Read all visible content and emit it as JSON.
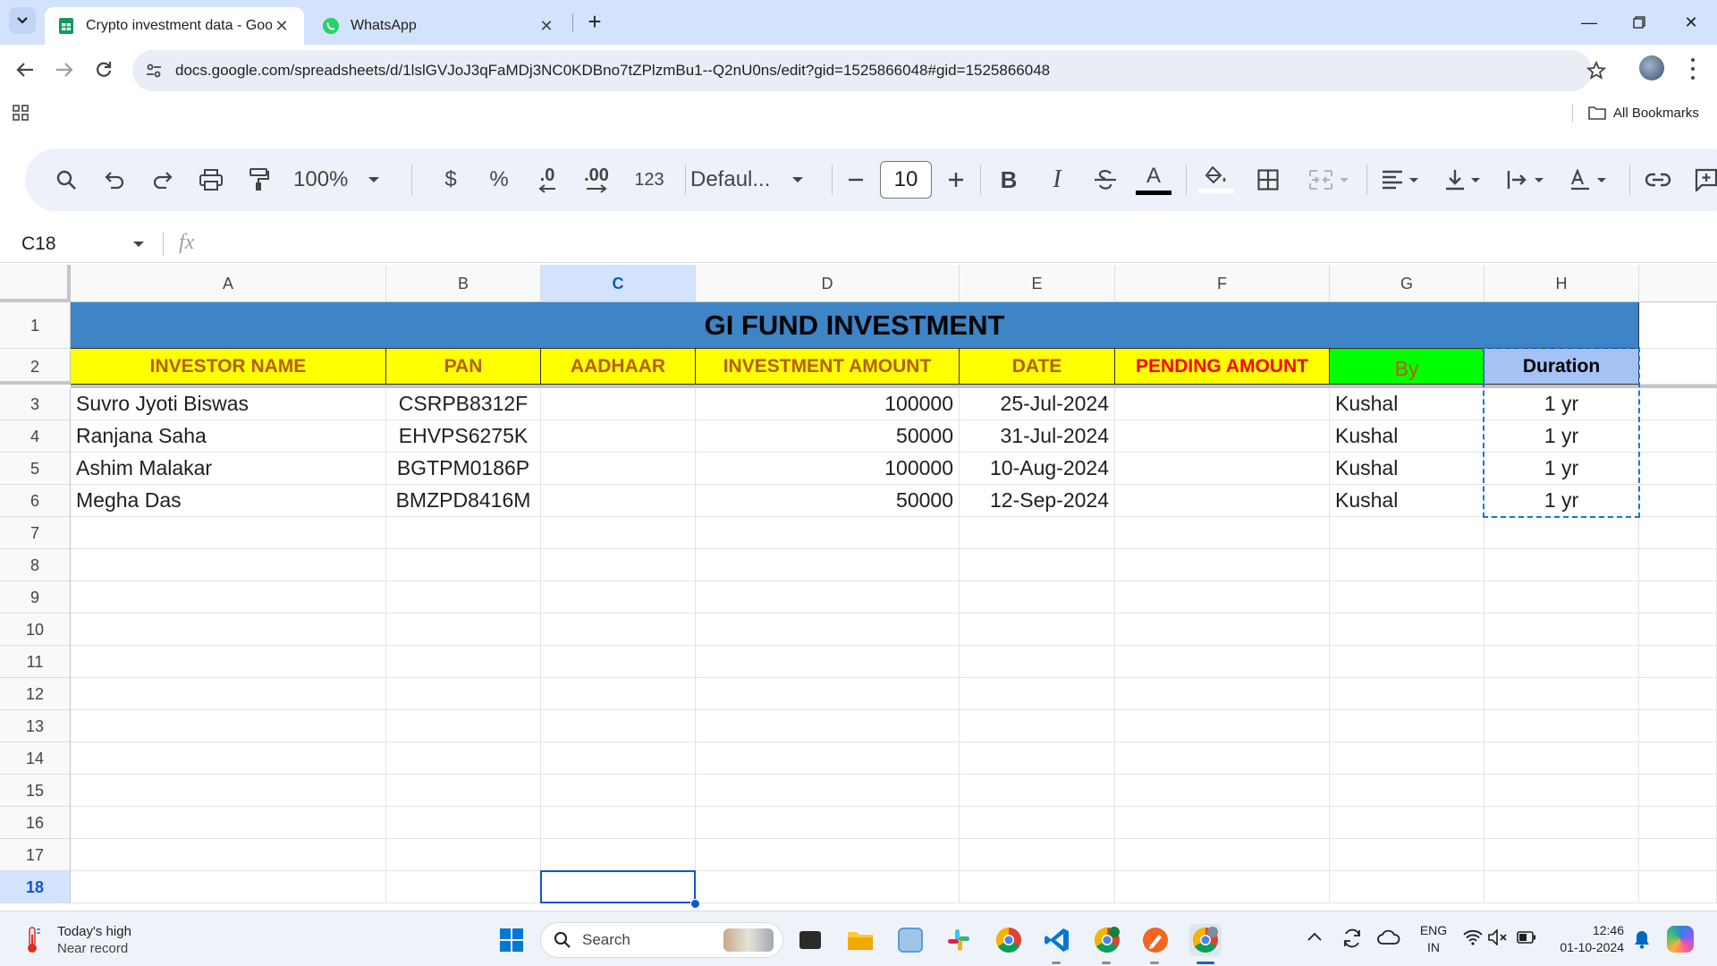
{
  "browser": {
    "tabs": [
      {
        "title": "Crypto investment data - Googl",
        "active": true
      },
      {
        "title": "WhatsApp",
        "active": false
      }
    ],
    "url": "docs.google.com/spreadsheets/d/1lslGVJoJ3qFaMDj3NC0KDBno7tZPlzmBu1--Q2nU0ns/edit?gid=1525866048#gid=1525866048",
    "bookmarks_label": "All Bookmarks"
  },
  "toolbar": {
    "zoom": "100%",
    "currency": "$",
    "percent": "%",
    "decrease_decimal": ".0",
    "increase_decimal": ".00",
    "number_format": "123",
    "font": "Defaul...",
    "font_size": "10"
  },
  "formula_bar": {
    "cell_ref": "C18",
    "fx": "fx"
  },
  "sheet": {
    "columns": [
      "A",
      "B",
      "C",
      "D",
      "E",
      "F",
      "G",
      "H"
    ],
    "row_numbers": [
      "1",
      "2",
      "3",
      "4",
      "5",
      "6",
      "7",
      "8",
      "9",
      "10",
      "11",
      "12",
      "13",
      "14",
      "15",
      "16",
      "17",
      "18"
    ],
    "title": "GI FUND INVESTMENT",
    "headers": [
      "INVESTOR NAME",
      "PAN",
      "AADHAAR",
      "INVESTMENT AMOUNT",
      "DATE",
      "PENDING AMOUNT",
      "By",
      "Duration"
    ],
    "rows": [
      [
        "Suvro Jyoti Biswas",
        "CSRPB8312F",
        "",
        "100000",
        "25-Jul-2024",
        "",
        "Kushal",
        "1 yr"
      ],
      [
        "Ranjana Saha",
        "EHVPS6275K",
        "",
        "50000",
        "31-Jul-2024",
        "",
        "Kushal",
        "1 yr"
      ],
      [
        "Ashim Malakar",
        "BGTPM0186P",
        "",
        "100000",
        "10-Aug-2024",
        "",
        "Kushal",
        "1 yr"
      ],
      [
        "Megha Das",
        "BMZPD8416M",
        "",
        "50000",
        "12-Sep-2024",
        "",
        "Kushal",
        "1 yr"
      ]
    ],
    "selected_cell": "C18",
    "colors": {
      "title_bg": "#3d85c6",
      "header_bg": "#ffff00",
      "header_text": "#b45f06",
      "pending_text": "#ff0000",
      "by_bg": "#00ff00",
      "duration_bg": "#a4c2f4",
      "selection": "#0b57d0"
    }
  },
  "taskbar": {
    "weather_title": "Today's high",
    "weather_sub": "Near record",
    "search_placeholder": "Search",
    "lang_top": "ENG",
    "lang_bottom": "IN",
    "time": "12:46",
    "date": "01-10-2024"
  }
}
